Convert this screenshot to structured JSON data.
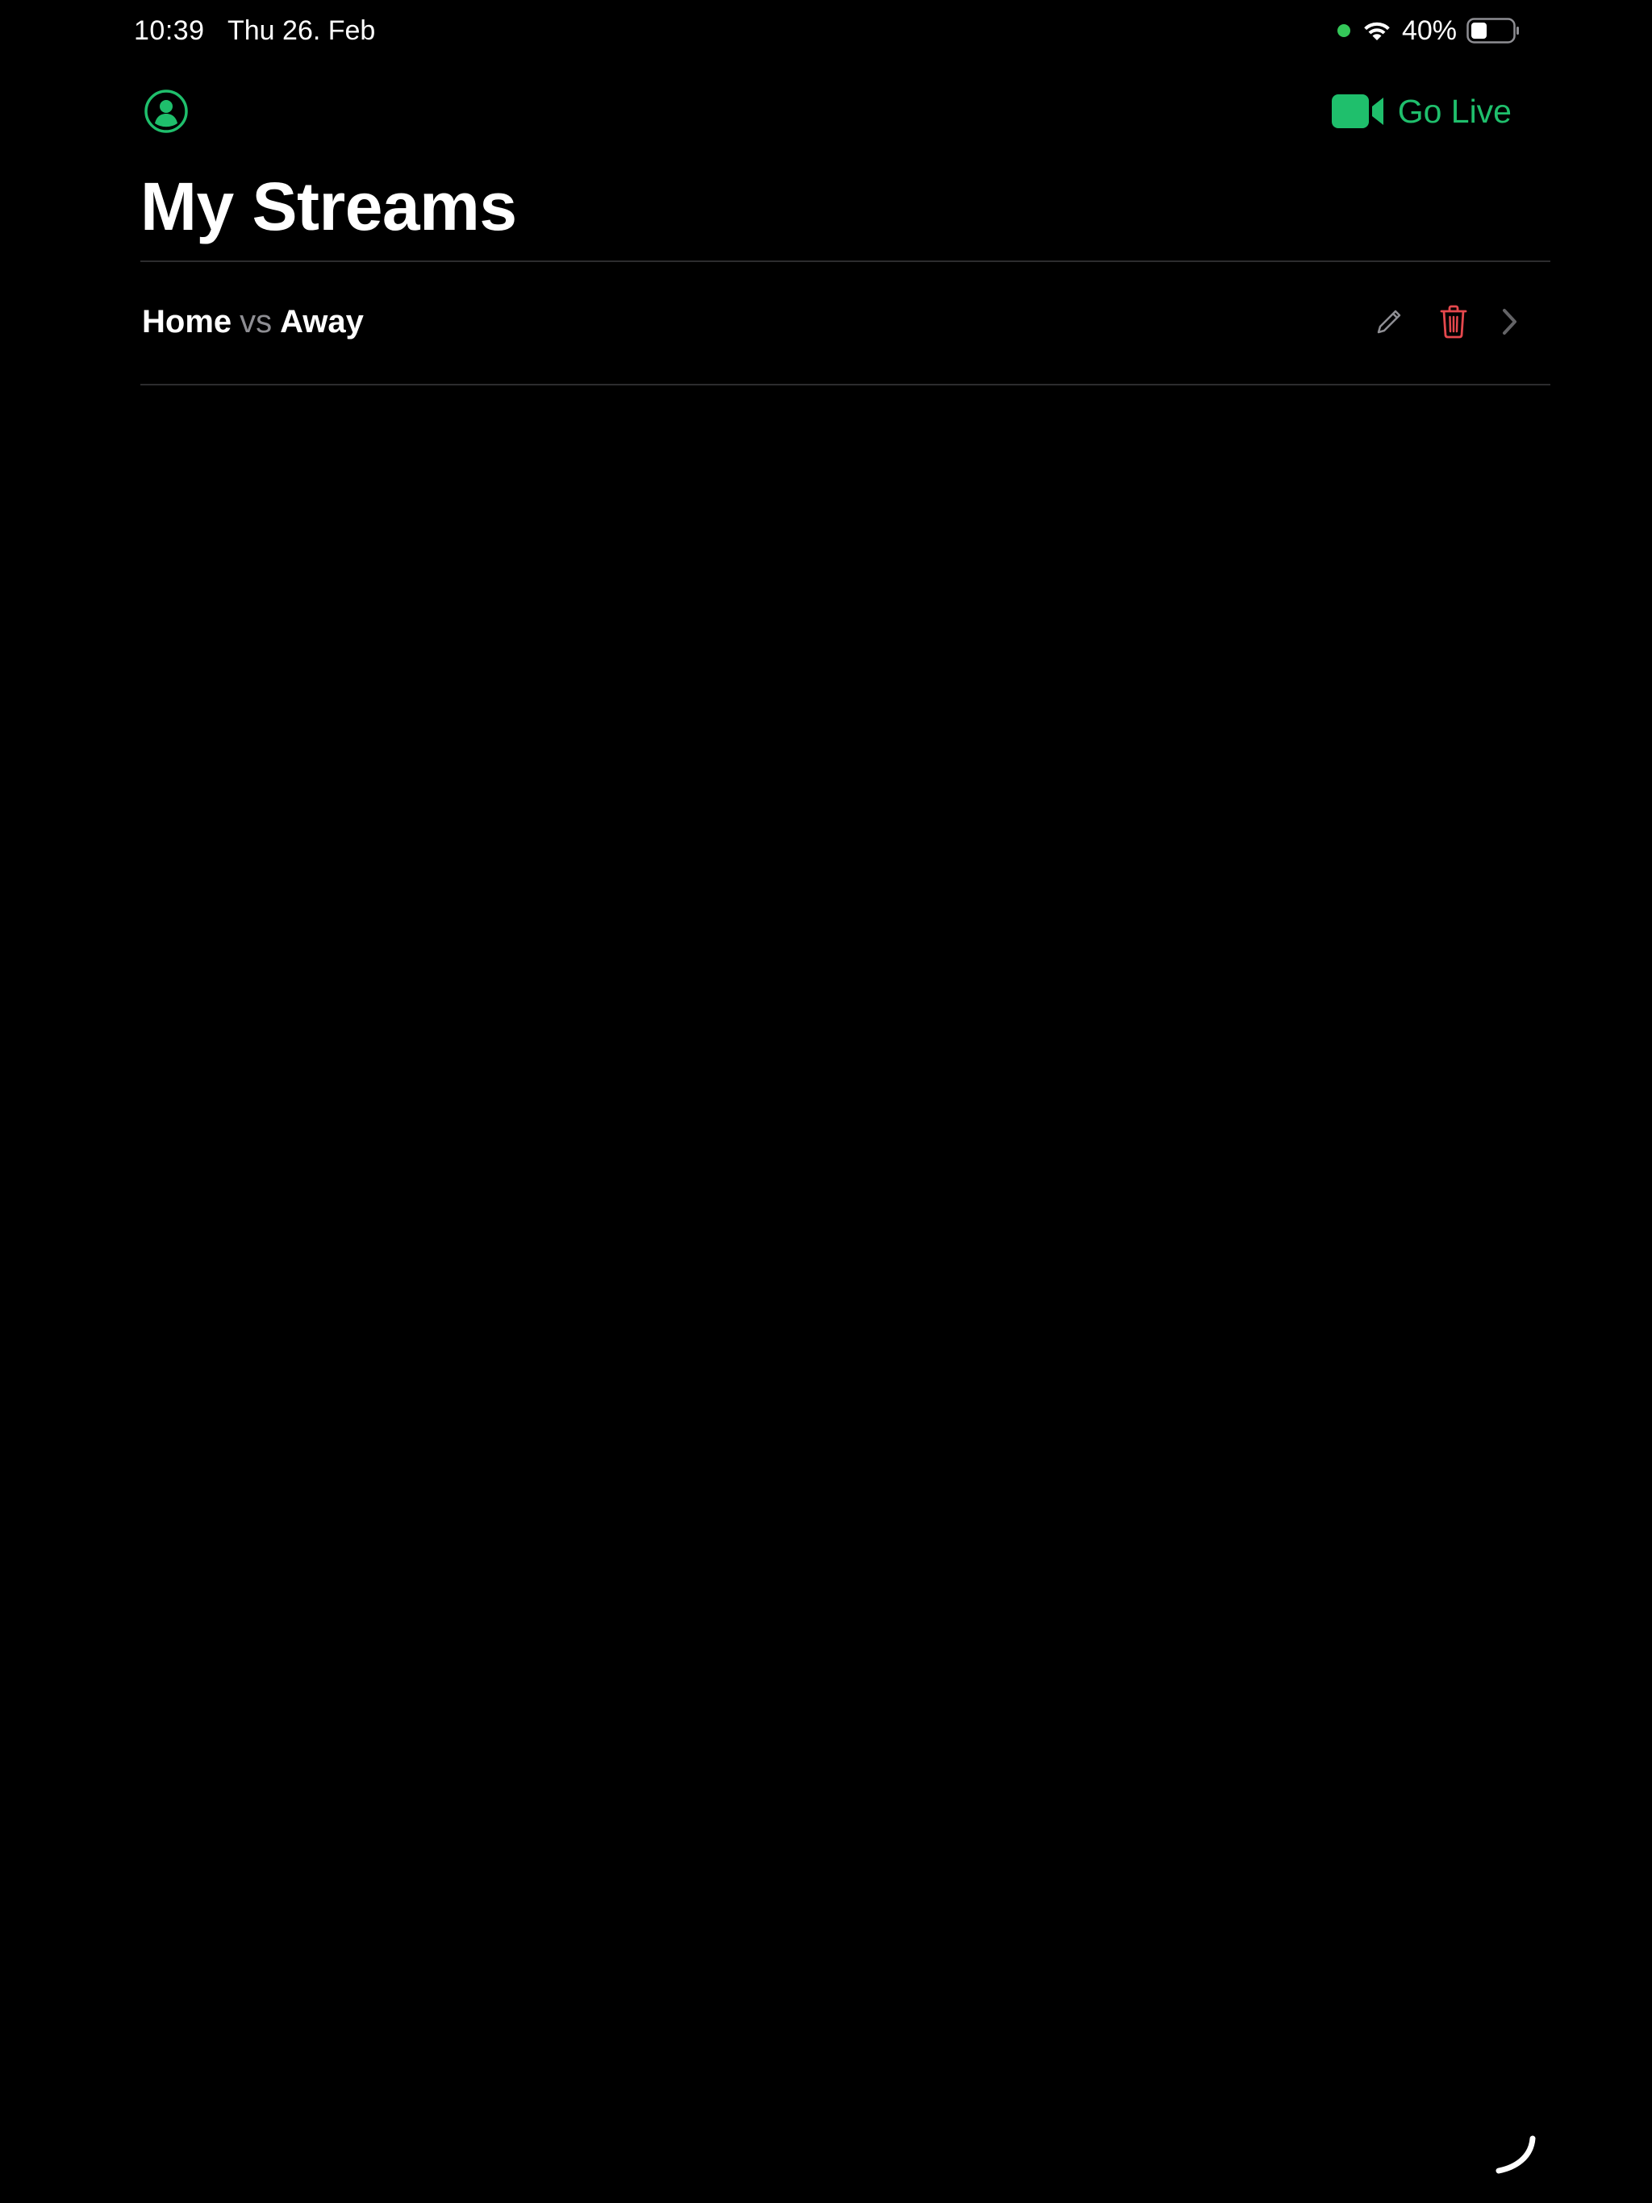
{
  "status_bar": {
    "time": "10:39",
    "date": "Thu 26. Feb",
    "battery_percent": "40%",
    "battery_level": 0.4,
    "mic_indicator_color": "#34c759"
  },
  "nav": {
    "profile_icon": "person-circle-icon",
    "go_live_label": "Go Live",
    "go_live_icon": "video-camera-icon",
    "accent_color": "#1fbf6c"
  },
  "page": {
    "title": "My Streams"
  },
  "streams": [
    {
      "home": "Home",
      "vs": "vs",
      "away": "Away",
      "edit_icon": "pencil-icon",
      "delete_icon": "trash-icon",
      "delete_color": "#e5484d",
      "disclosure_icon": "chevron-right-icon"
    }
  ]
}
